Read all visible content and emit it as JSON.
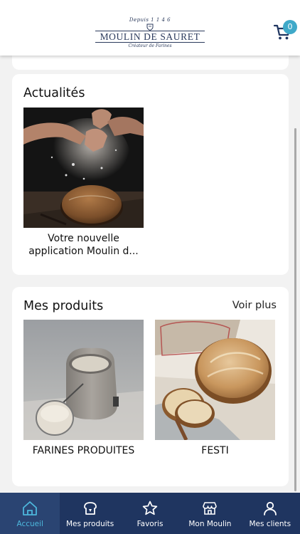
{
  "header": {
    "logo_since": "Depuis 1 1 4 6",
    "logo_name": "MOULIN DE SAURET",
    "logo_tagline": "Créateur de Farines",
    "cart_count": "0"
  },
  "news": {
    "title": "Actualités",
    "items": [
      {
        "label": "Votre nouvelle application Moulin d..."
      }
    ]
  },
  "products": {
    "title": "Mes produits",
    "see_more": "Voir plus",
    "items": [
      {
        "label": "FARINES PRODUITES"
      },
      {
        "label": "FESTI"
      }
    ]
  },
  "tabbar": {
    "tabs": [
      {
        "label": "Accueil",
        "icon": "home-icon",
        "active": true
      },
      {
        "label": "Mes produits",
        "icon": "bread-icon",
        "active": false
      },
      {
        "label": "Favoris",
        "icon": "star-icon",
        "active": false
      },
      {
        "label": "Mon Moulin",
        "icon": "store-icon",
        "active": false
      },
      {
        "label": "Mes clients",
        "icon": "person-icon",
        "active": false
      }
    ]
  },
  "colors": {
    "brand_navy": "#1f3560",
    "accent": "#3fa9c9"
  }
}
